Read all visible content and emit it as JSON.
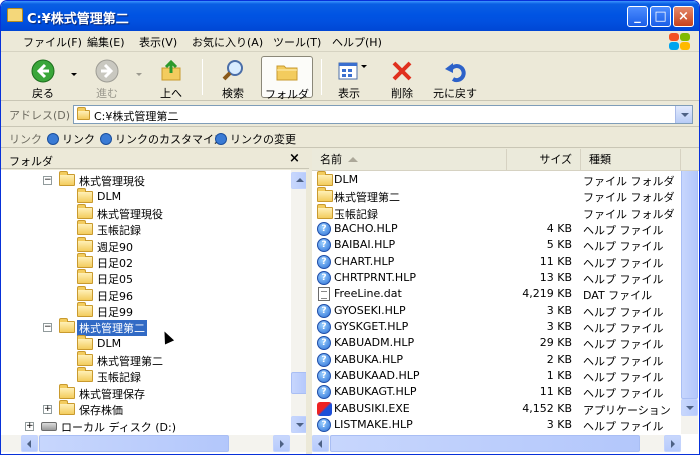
{
  "window": {
    "title": "C:¥株式管理第二",
    "minimize": "_",
    "maximize": "□",
    "close": "×"
  },
  "menu": [
    "ファイル(F)",
    "編集(E)",
    "表示(V)",
    "お気に入り(A)",
    "ツール(T)",
    "ヘルプ(H)"
  ],
  "toolbar": {
    "back": "戻る",
    "forward": "進む",
    "up": "上へ",
    "search": "検索",
    "folders": "フォルダ",
    "views": "表示",
    "delete": "削除",
    "undo": "元に戻す"
  },
  "address": {
    "label": "アドレス(D)",
    "value": "C:¥株式管理第二"
  },
  "links": {
    "label": "リンク",
    "items": [
      "リンク",
      "リンクのカスタマイズ",
      "リンクの変更"
    ]
  },
  "tree": {
    "header": "フォルダ",
    "close": "×",
    "items": [
      {
        "label": "株式管理現役",
        "expander": "−"
      },
      {
        "label": "DLM"
      },
      {
        "label": "株式管理現役"
      },
      {
        "label": "玉帳記録"
      },
      {
        "label": "週足90"
      },
      {
        "label": "日足02"
      },
      {
        "label": "日足05"
      },
      {
        "label": "日足96"
      },
      {
        "label": "日足99"
      },
      {
        "label": "株式管理第二",
        "expander": "−",
        "selected": true
      },
      {
        "label": "DLM"
      },
      {
        "label": "株式管理第二"
      },
      {
        "label": "玉帳記録"
      },
      {
        "label": "株式管理保存"
      },
      {
        "label": "保存株価",
        "expander": "+"
      },
      {
        "label": "ローカル ディスク (D:)",
        "expander": "+"
      }
    ]
  },
  "list": {
    "columns": {
      "name": "名前",
      "size": "サイズ",
      "type": "種類"
    },
    "rows": [
      {
        "icon": "folder",
        "name": "DLM",
        "size": "",
        "type": "ファイル フォルダ"
      },
      {
        "icon": "folder",
        "name": "株式管理第二",
        "size": "",
        "type": "ファイル フォルダ"
      },
      {
        "icon": "folder",
        "name": "玉帳記録",
        "size": "",
        "type": "ファイル フォルダ"
      },
      {
        "icon": "help",
        "name": "BACHO.HLP",
        "size": "4 KB",
        "type": "ヘルプ ファイル"
      },
      {
        "icon": "help",
        "name": "BAIBAI.HLP",
        "size": "5 KB",
        "type": "ヘルプ ファイル"
      },
      {
        "icon": "help",
        "name": "CHART.HLP",
        "size": "11 KB",
        "type": "ヘルプ ファイル"
      },
      {
        "icon": "help",
        "name": "CHRTPRNT.HLP",
        "size": "13 KB",
        "type": "ヘルプ ファイル"
      },
      {
        "icon": "doc",
        "name": "FreeLine.dat",
        "size": "4,219 KB",
        "type": "DAT ファイル"
      },
      {
        "icon": "help",
        "name": "GYOSEKI.HLP",
        "size": "3 KB",
        "type": "ヘルプ ファイル"
      },
      {
        "icon": "help",
        "name": "GYSKGET.HLP",
        "size": "3 KB",
        "type": "ヘルプ ファイル"
      },
      {
        "icon": "help",
        "name": "KABUADM.HLP",
        "size": "29 KB",
        "type": "ヘルプ ファイル"
      },
      {
        "icon": "help",
        "name": "KABUKA.HLP",
        "size": "2 KB",
        "type": "ヘルプ ファイル"
      },
      {
        "icon": "help",
        "name": "KABUKAAD.HLP",
        "size": "1 KB",
        "type": "ヘルプ ファイル"
      },
      {
        "icon": "help",
        "name": "KABUKAGT.HLP",
        "size": "11 KB",
        "type": "ヘルプ ファイル"
      },
      {
        "icon": "exe",
        "name": "KABUSIKI.EXE",
        "size": "4,152 KB",
        "type": "アプリケーション"
      },
      {
        "icon": "help",
        "name": "LISTMAKE.HLP",
        "size": "3 KB",
        "type": "ヘルプ ファイル"
      }
    ]
  },
  "colors": {
    "titlebar": "#0054e3",
    "selection": "#316ac5",
    "chrome": "#ece9d8"
  }
}
